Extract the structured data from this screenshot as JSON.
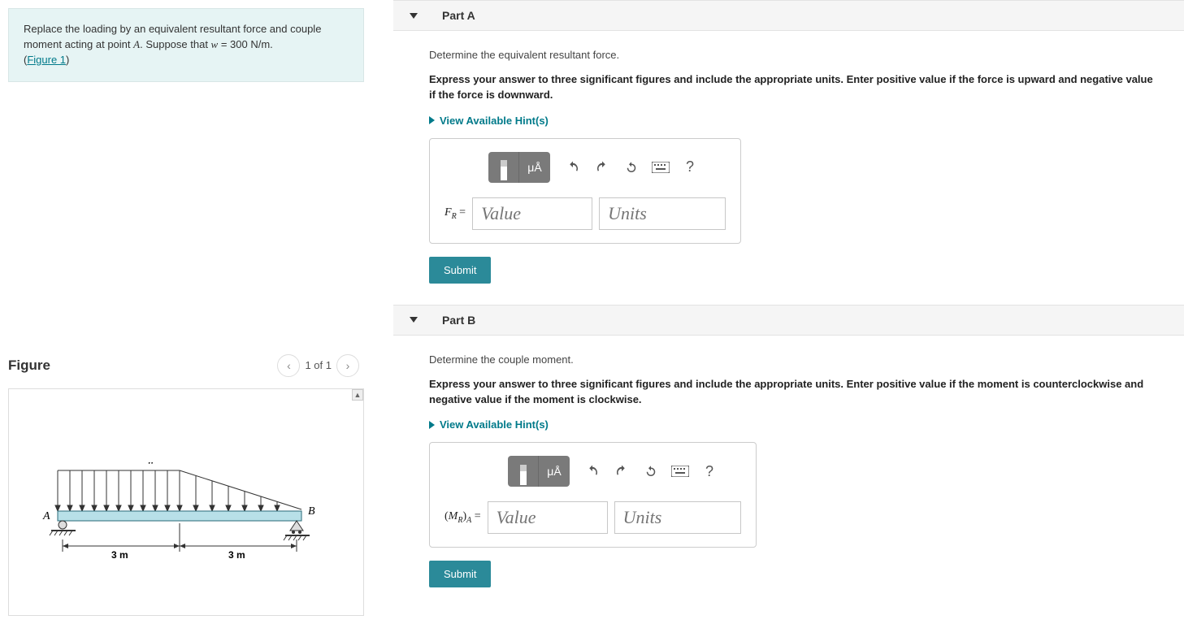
{
  "problem": {
    "text_1": "Replace the loading by an equivalent resultant force and couple moment acting at point ",
    "var_A": "A",
    "text_2": ". Suppose that ",
    "var_w": "w",
    "text_3": " = 300 N/m.",
    "figure_link": "Figure 1"
  },
  "figure": {
    "title": "Figure",
    "counter": "1 of 1",
    "label_w": "w",
    "label_A": "A",
    "label_B": "B",
    "dim1": "3 m",
    "dim2": "3 m"
  },
  "partA": {
    "title": "Part A",
    "prompt": "Determine the equivalent resultant force.",
    "express": "Express your answer to three significant figures and include the appropriate units. Enter positive value if the force is upward and negative value if the force is downward.",
    "hints": "View Available Hint(s)",
    "label_html": "F",
    "label_sub": "R",
    "eq": " = ",
    "value_ph": "Value",
    "units_ph": "Units",
    "submit": "Submit"
  },
  "partB": {
    "title": "Part B",
    "prompt": "Determine the couple moment.",
    "express": "Express your answer to three significant figures and include the appropriate units. Enter positive value if the moment is counterclockwise and negative value if the moment is clockwise.",
    "hints": "View Available Hint(s)",
    "label_pre": "(",
    "label_M": "M",
    "label_sub1": "R",
    "label_post": ")",
    "label_sub2": "A",
    "eq": " = ",
    "value_ph": "Value",
    "units_ph": "Units",
    "submit": "Submit"
  },
  "toolbar": {
    "units_btn": "μÅ",
    "help": "?"
  }
}
